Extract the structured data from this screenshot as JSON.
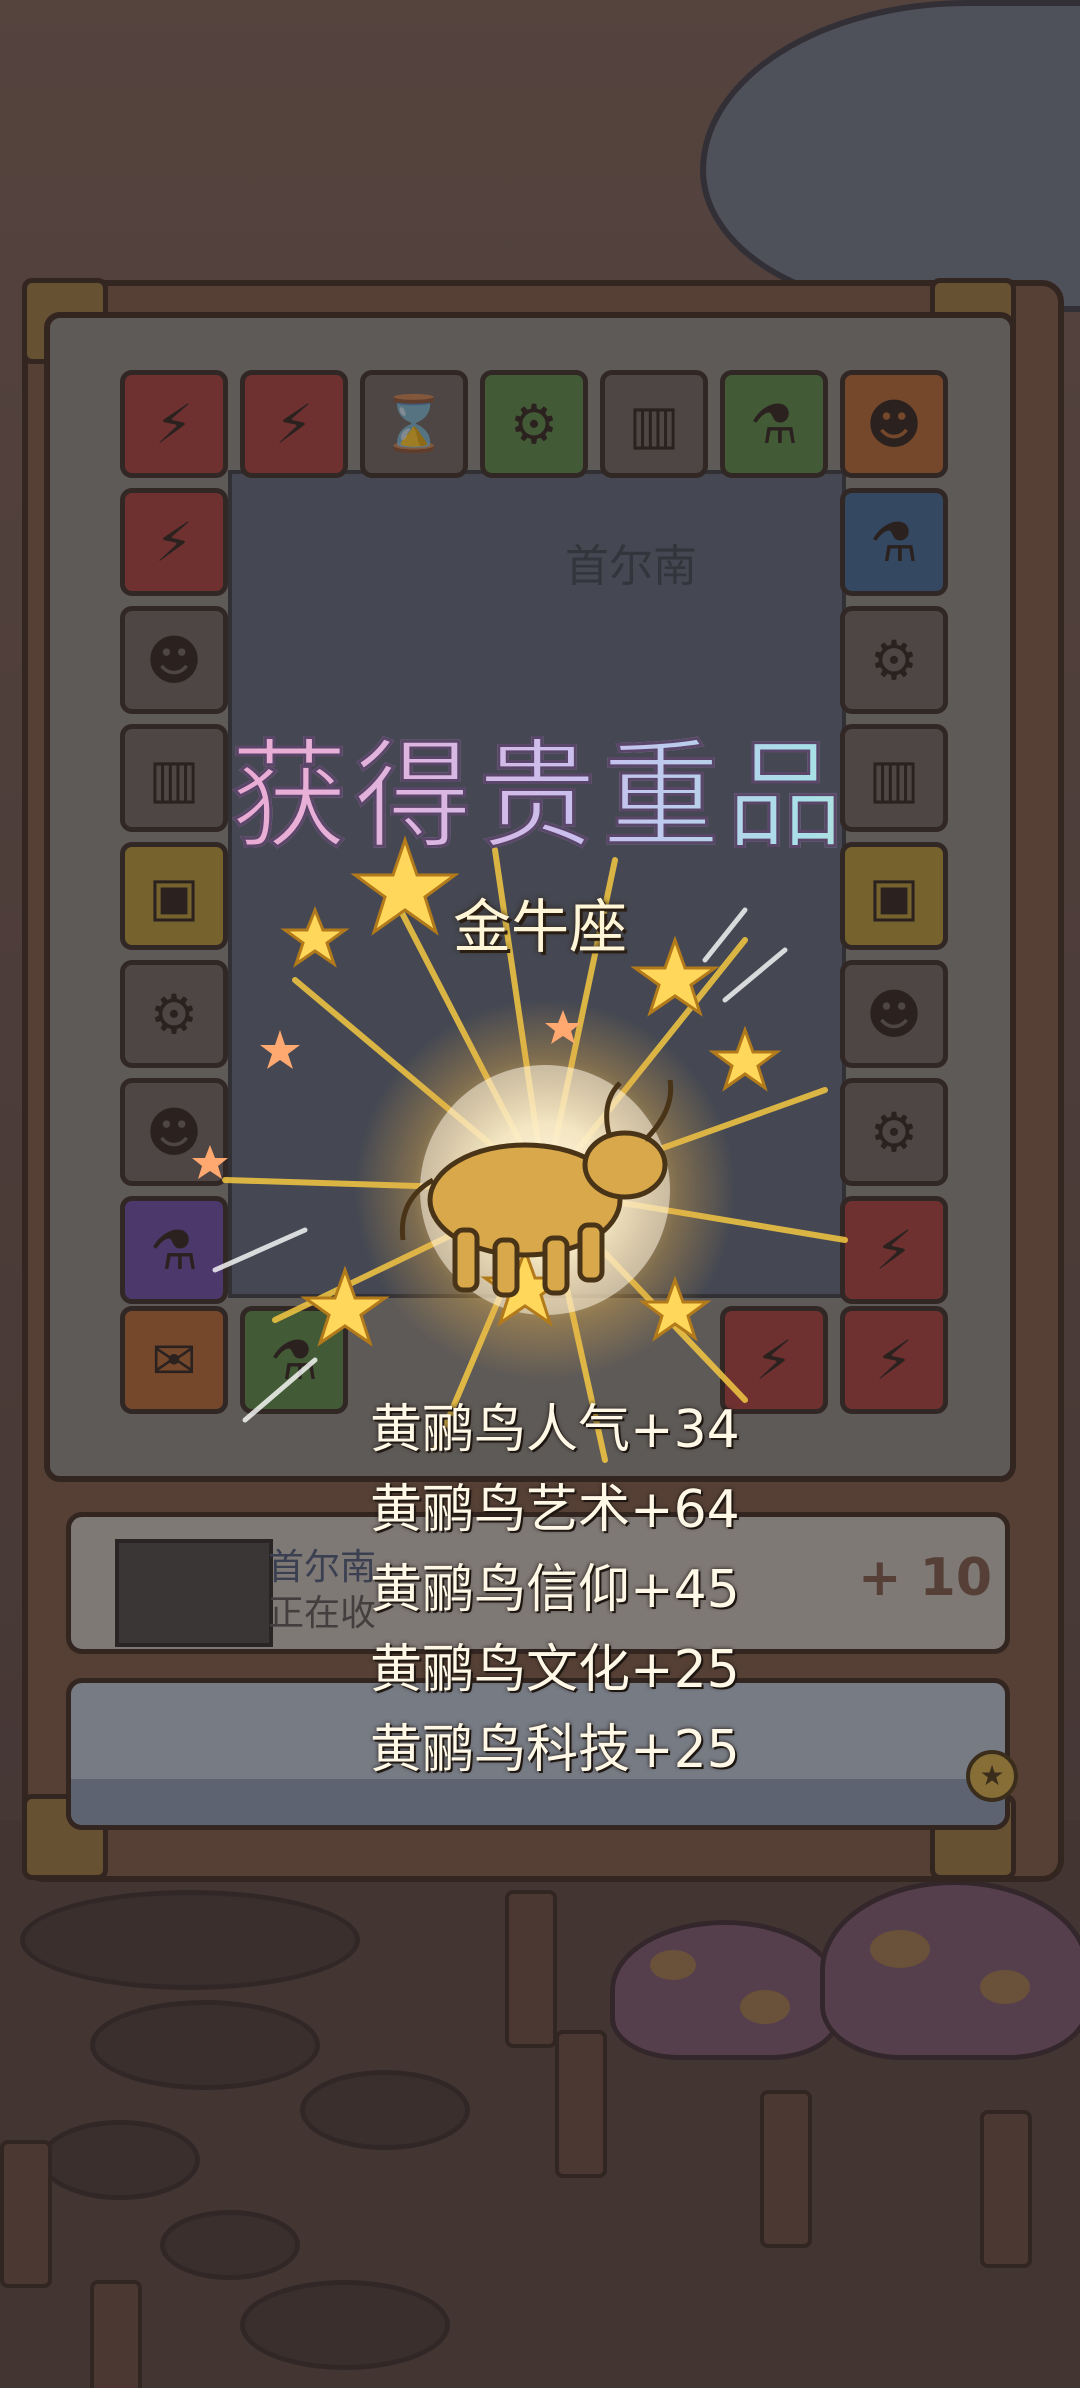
{
  "overlay": {
    "title": "获得贵重品",
    "item_name": "金牛座",
    "rewards": [
      "黄鹂鸟人气+34",
      "黄鹂鸟艺术+64",
      "黄鹂鸟信仰+45",
      "黄鹂鸟文化+25",
      "黄鹂鸟科技+25"
    ]
  },
  "board": {
    "map_label": "首尔南"
  },
  "task_panel": {
    "city": "首尔南",
    "status": "正在收",
    "plus": "+ 10"
  },
  "colors": {
    "title_gradient": [
      "#f0a0c8",
      "#c8c0f0",
      "#a8e0e8",
      "#f0e0a0"
    ],
    "burst_gold": "#f5c842"
  }
}
